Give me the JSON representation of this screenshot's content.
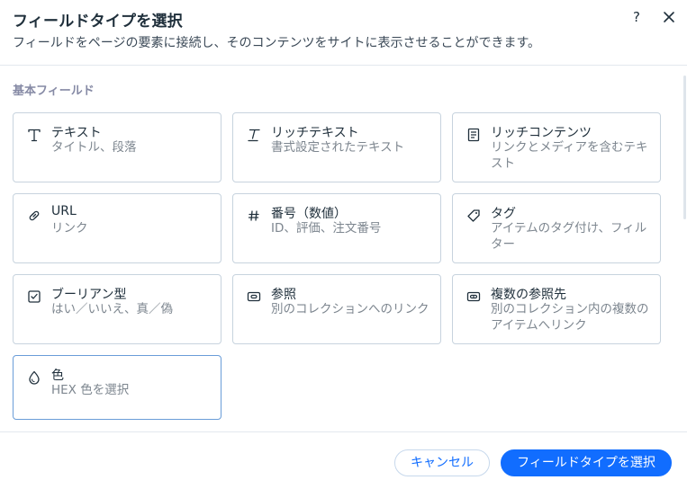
{
  "dialog": {
    "title": "フィールドタイプを選択",
    "subtitle": "フィールドをページの要素に接続し、そのコンテンツをサイトに表示させることができます。",
    "help_label": "?"
  },
  "section": {
    "label": "基本フィールド"
  },
  "cards": [
    {
      "title": "テキスト",
      "desc": "タイトル、段落",
      "icon": "text-icon"
    },
    {
      "title": "リッチテキスト",
      "desc": "書式設定されたテキスト",
      "icon": "rich-text-icon"
    },
    {
      "title": "リッチコンテンツ",
      "desc": "リンクとメディアを含むテキスト",
      "icon": "document-icon"
    },
    {
      "title": "URL",
      "desc": "リンク",
      "icon": "link-icon"
    },
    {
      "title": "番号（数値）",
      "desc": "ID、評価、注文番号",
      "icon": "hash-icon"
    },
    {
      "title": "タグ",
      "desc": "アイテムのタグ付け、フィルター",
      "icon": "tag-icon"
    },
    {
      "title": "ブーリアン型",
      "desc": "はい／いいえ、真／偽",
      "icon": "checkbox-icon"
    },
    {
      "title": "参照",
      "desc": "別のコレクションへのリンク",
      "icon": "reference-icon"
    },
    {
      "title": "複数の参照先",
      "desc": "別のコレクション内の複数のアイテムへリンク",
      "icon": "multi-reference-icon"
    },
    {
      "title": "色",
      "desc": "HEX 色を選択",
      "icon": "color-drop-icon"
    }
  ],
  "footer": {
    "cancel_label": "キャンセル",
    "confirm_label": "フィールドタイプを選択"
  },
  "colors": {
    "accent": "#116dff",
    "card_border": "#c7d3de",
    "selected_border": "#6a9dd8",
    "muted_text": "#7d868f"
  }
}
